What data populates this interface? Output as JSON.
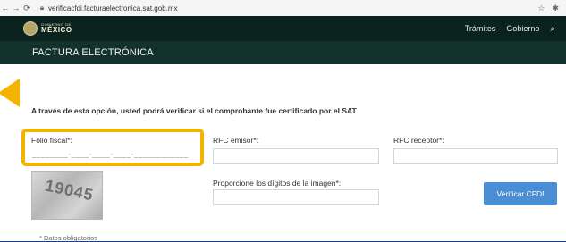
{
  "browser": {
    "url": "verificacfdi.facturaelectronica.sat.gob.mx",
    "icons": [
      "back-icon",
      "forward-icon",
      "reload-icon",
      "lock-icon",
      "star-icon",
      "pin-icon"
    ]
  },
  "gov_header": {
    "logo_small": "GOBIERNO DE",
    "logo_big": "MÉXICO",
    "nav": [
      "Trámites",
      "Gobierno"
    ]
  },
  "section": {
    "title": "FACTURA ELECTRÓNICA"
  },
  "form": {
    "intro": "A través de esta opción, usted podrá verificar si el comprobante fue certificado por el SAT",
    "folio_label": "Folio fiscal*:",
    "folio_mask": "________-____-____-____-____________",
    "rfc_emisor_label": "RFC emisor*:",
    "rfc_receptor_label": "RFC receptor*:",
    "captcha_label": "Proporcione los dígitos de la imagen*:",
    "captcha_text": "19045",
    "verify_button": "Verificar CFDI",
    "required_note": "* Datos obligatorios"
  },
  "colors": {
    "accent": "#f2b400",
    "header": "#0b231e",
    "section_bar": "#13322b",
    "button": "#4a8fd6",
    "backdrop": "#1e3a8a"
  }
}
